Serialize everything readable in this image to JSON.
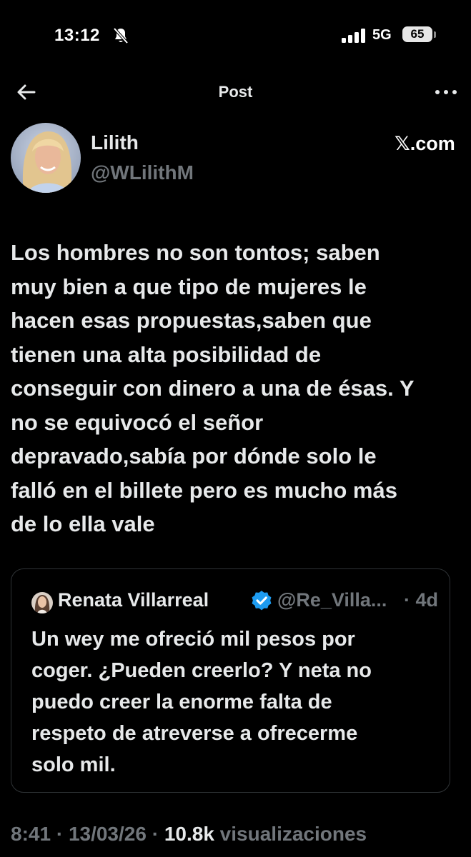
{
  "status_bar": {
    "time": "13:12",
    "network": "5G",
    "battery": "65"
  },
  "nav": {
    "title": "Post"
  },
  "author": {
    "name": "Lilith",
    "handle": "@WLilithM",
    "site": "𝕏.com"
  },
  "tweet": {
    "lines": [
      "Los hombres no son tontos; saben",
      "muy bien a que tipo de mujeres le",
      "hacen esas propuestas,saben que",
      "tienen una alta posibilidad de",
      "conseguir con dinero a una de ésas. Y",
      "no se equivocó el señor",
      "depravado,sabía por dónde solo le",
      "falló en el billete pero es mucho más",
      "de lo ella vale"
    ]
  },
  "quote": {
    "name": "Renata Villarreal",
    "handle": "@Re_Villa...",
    "time": "· 4d",
    "lines": [
      "Un wey me ofreció mil pesos por",
      "coger. ¿Pueden creerlo? Y neta no",
      "puedo creer la enorme falta de",
      "respeto de atreverse a ofrecerme",
      "solo mil."
    ]
  },
  "meta": {
    "time": "8:41",
    "sep1": " · ",
    "date": "13/03/26",
    "sep2": " · ",
    "views": "10.8k",
    "views_label": " visualizaciones"
  },
  "icons": {
    "back": "arrow-left-icon",
    "more": "more-horizontal-icon",
    "verified": "verified-badge-icon",
    "bell_muted": "bell-slash-icon"
  },
  "colors": {
    "background": "#000000",
    "text": "#e7e9ea",
    "muted": "#71767b",
    "verified": "#1d9bf0",
    "border": "#2f3336"
  }
}
